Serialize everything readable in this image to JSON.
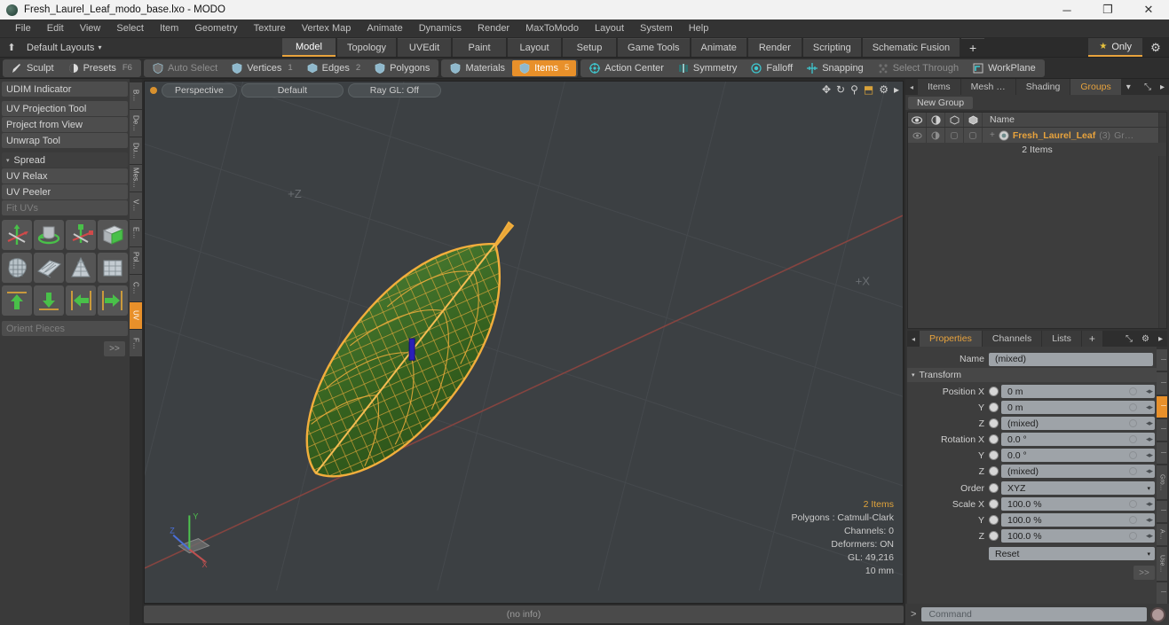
{
  "titlebar": {
    "title": "Fresh_Laurel_Leaf_modo_base.lxo - MODO",
    "app_icon": "modo-icon",
    "minimize": "─",
    "maximize": "❐",
    "close": "✕"
  },
  "menubar": {
    "items": [
      "File",
      "Edit",
      "View",
      "Select",
      "Item",
      "Geometry",
      "Texture",
      "Vertex Map",
      "Animate",
      "Dynamics",
      "Render",
      "MaxToModo",
      "Layout",
      "System",
      "Help"
    ]
  },
  "layoutbar": {
    "up_icon": "⬆",
    "default_layouts": "Default Layouts",
    "caret": "▾",
    "tabs": [
      {
        "label": "Model",
        "active": true
      },
      {
        "label": "Topology",
        "active": false
      },
      {
        "label": "UVEdit",
        "active": false
      },
      {
        "label": "Paint",
        "active": false
      },
      {
        "label": "Layout",
        "active": false
      },
      {
        "label": "Setup",
        "active": false
      },
      {
        "label": "Game Tools",
        "active": false
      },
      {
        "label": "Animate",
        "active": false
      },
      {
        "label": "Render",
        "active": false
      },
      {
        "label": "Scripting",
        "active": false
      },
      {
        "label": "Schematic Fusion",
        "active": false
      }
    ],
    "add_tab": "+",
    "only_label": "Only",
    "star_icon": "★",
    "gear_icon": "⚙"
  },
  "modebar": {
    "group1": [
      {
        "label": "Sculpt",
        "icon": "brush-icon",
        "active": false,
        "dim": false,
        "num": ""
      },
      {
        "label": "Presets",
        "icon": "sphere-icon",
        "active": false,
        "dim": false,
        "num": "F6"
      }
    ],
    "group2": [
      {
        "label": "Auto Select",
        "icon": "shield-icon",
        "active": false,
        "dim": true,
        "num": ""
      },
      {
        "label": "Vertices",
        "icon": "shield-icon",
        "active": false,
        "dim": false,
        "num": "1"
      },
      {
        "label": "Edges",
        "icon": "cube-icon",
        "active": false,
        "dim": false,
        "num": "2"
      },
      {
        "label": "Polygons",
        "icon": "shield-icon",
        "active": false,
        "dim": false,
        "num": ""
      }
    ],
    "group3": [
      {
        "label": "Materials",
        "icon": "shield-icon",
        "active": false,
        "dim": false,
        "num": ""
      },
      {
        "label": "Items",
        "icon": "shield-icon",
        "active": true,
        "dim": false,
        "num": "5"
      }
    ],
    "group4": [
      {
        "label": "Action Center",
        "icon": "target-icon",
        "active": false,
        "dim": false,
        "num": ""
      },
      {
        "label": "Symmetry",
        "icon": "mirror-icon",
        "active": false,
        "dim": false,
        "num": ""
      },
      {
        "label": "Falloff",
        "icon": "circle-icon",
        "active": false,
        "dim": false,
        "num": ""
      },
      {
        "label": "Snapping",
        "icon": "crosshair-icon",
        "active": false,
        "dim": false,
        "num": ""
      },
      {
        "label": "Select Through",
        "icon": "dots-icon",
        "active": false,
        "dim": true,
        "num": ""
      },
      {
        "label": "WorkPlane",
        "icon": "plane-icon",
        "active": false,
        "dim": false,
        "num": ""
      }
    ]
  },
  "leftpanel": {
    "group_a": [
      {
        "label": "UDIM Indicator",
        "dim": false
      }
    ],
    "group_b": [
      {
        "label": "UV Projection Tool",
        "dim": false
      },
      {
        "label": "Project from View",
        "dim": false
      },
      {
        "label": "Unwrap Tool",
        "dim": false
      }
    ],
    "spread_header": "Spread",
    "tri": "▾",
    "group_c": [
      {
        "label": "UV Relax",
        "dim": false
      },
      {
        "label": "UV Peeler",
        "dim": false
      },
      {
        "label": "Fit UVs",
        "dim": true
      }
    ],
    "icon_rows": [
      [
        "uv-move-axis-icon",
        "uv-rotate-icon",
        "uv-scale-axis-icon",
        "uv-box-icon"
      ],
      [
        "uv-sphere-unwrap-icon",
        "uv-grid-flat-icon",
        "uv-cone-icon",
        "uv-cube-unwrap-icon"
      ],
      [
        "uv-align-up-icon",
        "uv-align-down-icon",
        "uv-align-left-icon",
        "uv-align-right-icon"
      ]
    ],
    "orient_pieces": "Orient Pieces",
    "go_label": ">>"
  },
  "vertical_tabs": [
    {
      "label": "B…",
      "active": false
    },
    {
      "label": "De…",
      "active": false
    },
    {
      "label": "Du…",
      "active": false
    },
    {
      "label": "Mes…",
      "active": false
    },
    {
      "label": "V…",
      "active": false
    },
    {
      "label": "E…",
      "active": false
    },
    {
      "label": "Pol…",
      "active": false
    },
    {
      "label": "C…",
      "active": false
    },
    {
      "label": "UV",
      "active": true
    },
    {
      "label": "F…",
      "active": false
    }
  ],
  "viewport": {
    "view_mode": "Perspective",
    "shading": "Default",
    "raygl": "Ray GL: Off",
    "tools": [
      {
        "icon": "pan-icon",
        "glyph": "✥"
      },
      {
        "icon": "rotate-icon",
        "glyph": "↻"
      },
      {
        "icon": "zoom-icon",
        "glyph": "⚲"
      },
      {
        "icon": "fit-icon",
        "glyph": "⬒"
      },
      {
        "icon": "gear-icon",
        "glyph": "⚙"
      },
      {
        "icon": "chevron-right-icon",
        "glyph": "▸"
      }
    ],
    "stats": {
      "items": "2 Items",
      "polygons": "Polygons : Catmull-Clark",
      "channels": "Channels: 0",
      "deformers": "Deformers: ON",
      "gl": "GL: 49,216",
      "scale": "10 mm"
    },
    "axis_gizmo": {
      "x": "X",
      "y": "Y",
      "z": "Z"
    },
    "colors": {
      "background": "#3c4043",
      "grid": "#4a4e52",
      "axis_x": "#8c4242",
      "leaf_fill": "#3a6b2a",
      "leaf_wire": "#f0a830"
    }
  },
  "statusbar": {
    "text": "(no info)"
  },
  "rightpanel": {
    "top_tabs": [
      {
        "label": "Items",
        "active": false
      },
      {
        "label": "Mesh …",
        "active": false
      },
      {
        "label": "Shading",
        "active": false
      },
      {
        "label": "Groups",
        "active": true
      }
    ],
    "top_caret": "▾",
    "expand_icon": "⤡",
    "arrow_icon": "▸",
    "left_arrow": "◂",
    "new_group": "New Group",
    "list": {
      "name_header": "Name",
      "col_icons": [
        "eye-icon",
        "render-icon",
        "cube-outline-icon",
        "cube-solid-icon"
      ],
      "rows": [
        {
          "plus": "+",
          "icon": "group-icon",
          "name": "Fresh_Laurel_Leaf",
          "count": "(3)",
          "extra": "Gr…",
          "selected": true
        }
      ],
      "subrow": "2 Items"
    },
    "props_tabs": [
      {
        "label": "Properties",
        "active": true
      },
      {
        "label": "Channels",
        "active": false
      },
      {
        "label": "Lists",
        "active": false
      },
      {
        "label": "+",
        "active": false
      }
    ],
    "props_gear": "⚙",
    "props_expand": "⤡",
    "props_arrow": "▸",
    "name_label": "Name",
    "name_value": "(mixed)",
    "transform_header": "Transform",
    "transform_tri": "▾",
    "fields": [
      {
        "label": "Position X",
        "value": "0 m",
        "type": "field"
      },
      {
        "label": "Y",
        "value": "0 m",
        "type": "field"
      },
      {
        "label": "Z",
        "value": "(mixed)",
        "type": "field"
      },
      {
        "label": "Rotation X",
        "value": "0.0 °",
        "type": "field"
      },
      {
        "label": "Y",
        "value": "0.0 °",
        "type": "field"
      },
      {
        "label": "Z",
        "value": "(mixed)",
        "type": "field"
      },
      {
        "label": "Order",
        "value": "XYZ",
        "type": "dropdown"
      },
      {
        "label": "Scale X",
        "value": "100.0 %",
        "type": "field"
      },
      {
        "label": "Y",
        "value": "100.0 %",
        "type": "field"
      },
      {
        "label": "Z",
        "value": "100.0 %",
        "type": "field"
      }
    ],
    "reset_dropdown": "Reset",
    "reset_go": ">>",
    "side_tabs": [
      {
        "label": "⠇",
        "active": false
      },
      {
        "label": "⠇",
        "active": false
      },
      {
        "label": "⠇",
        "active": true
      },
      {
        "label": "⠇",
        "active": false
      },
      {
        "label": "⠇",
        "active": false
      },
      {
        "label": "Gro…",
        "active": false
      },
      {
        "label": "⠇",
        "active": false
      },
      {
        "label": "A…",
        "active": false
      },
      {
        "label": "Use…",
        "active": false
      },
      {
        "label": "⠇",
        "active": false
      }
    ]
  },
  "commandbar": {
    "prompt": ">",
    "placeholder": "Command",
    "record_icon": "record-icon"
  }
}
